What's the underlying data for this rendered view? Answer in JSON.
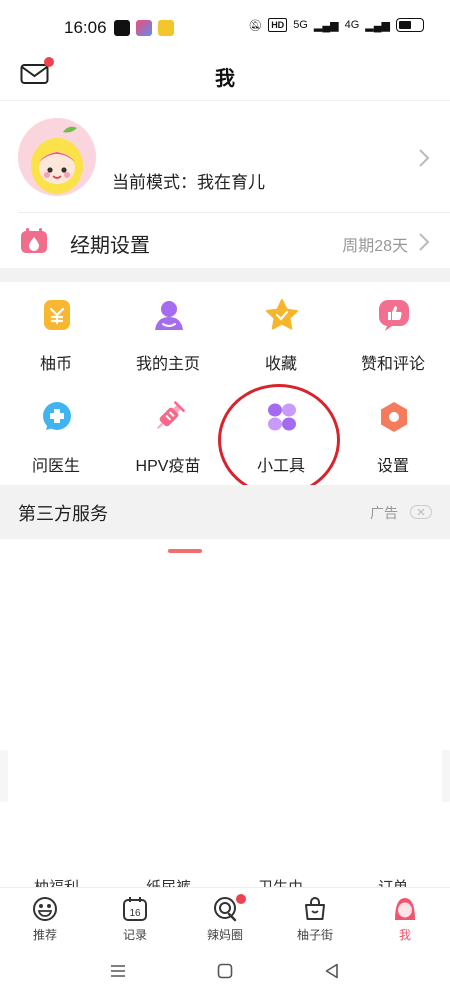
{
  "status_bar": {
    "time": "16:06",
    "network": [
      "5G",
      "4G"
    ],
    "hd": "HD"
  },
  "header": {
    "title": "我"
  },
  "profile": {
    "mode_text": "当前模式：我在育儿"
  },
  "period": {
    "label": "经期设置",
    "value": "周期28天"
  },
  "grid": [
    {
      "label": "柚币",
      "icon": "coin-icon",
      "color": "#f7b731"
    },
    {
      "label": "我的主页",
      "icon": "user-icon",
      "color": "#a66cf0"
    },
    {
      "label": "收藏",
      "icon": "star-icon",
      "color": "#f6b52b"
    },
    {
      "label": "赞和评论",
      "icon": "thumbs-up-icon",
      "color": "#f36f8f"
    },
    {
      "label": "问医生",
      "icon": "medical-chat-icon",
      "color": "#3fb4f0"
    },
    {
      "label": "HPV疫苗",
      "icon": "syringe-icon",
      "color": "#f56a8b"
    },
    {
      "label": "小工具",
      "icon": "tools-icon",
      "color": "#a46af0"
    },
    {
      "label": "设置",
      "icon": "settings-icon",
      "color": "#f47b5c"
    }
  ],
  "third_party": {
    "title": "第三方服务",
    "ad_label": "广告"
  },
  "peek_row": [
    "柚福利",
    "纸尿裤",
    "卫生巾",
    "订单"
  ],
  "tab_bar": [
    {
      "label": "推荐",
      "icon": "recommend-icon",
      "active": false
    },
    {
      "label": "记录",
      "icon": "calendar-icon",
      "active": false
    },
    {
      "label": "辣妈圈",
      "icon": "circle-icon",
      "active": false,
      "badge": true
    },
    {
      "label": "柚子街",
      "icon": "shopping-bag-icon",
      "active": false
    },
    {
      "label": "我",
      "icon": "me-icon",
      "active": true
    }
  ],
  "colors": {
    "accent": "#f0546f",
    "badge": "#f0424e",
    "annotation": "#d9222a"
  }
}
